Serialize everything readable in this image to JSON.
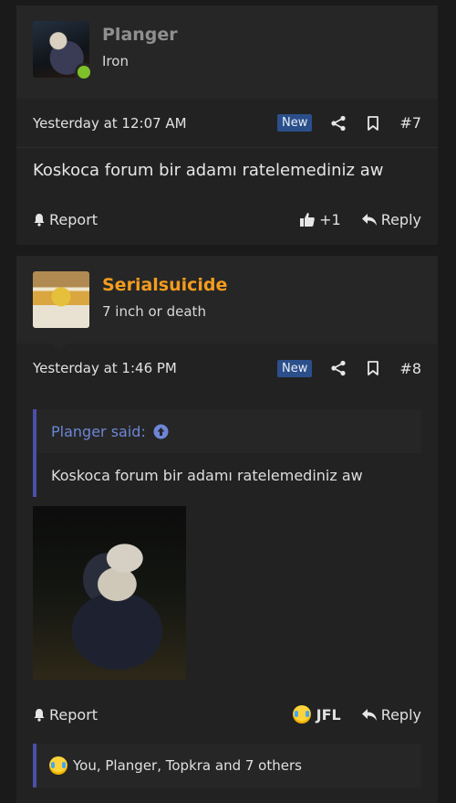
{
  "posts": [
    {
      "username": "Planger",
      "user_title": "Iron",
      "timestamp": "Yesterday at 12:07 AM",
      "badge": "New",
      "post_number": "#7",
      "message": "Koskoca forum bir adamı ratelemediniz aw",
      "actions": {
        "report": "Report",
        "reaction": "+1",
        "reply": "Reply"
      }
    },
    {
      "username": "Serialsuicide",
      "user_title": "7 inch or death",
      "timestamp": "Yesterday at 1:46 PM",
      "badge": "New",
      "post_number": "#8",
      "quote": {
        "author": "Planger said:",
        "text": "Koskoca forum bir adamı ratelemediniz aw"
      },
      "actions": {
        "report": "Report",
        "reaction": "JFL",
        "reply": "Reply"
      },
      "reactions_summary": "You, Planger, Topkra and 7 others"
    }
  ],
  "colors": {
    "username_orange": "#f39c1f",
    "online": "#7fc12a",
    "badge_new": "#2b4f8a",
    "quote_accent": "#4a4fa8"
  }
}
